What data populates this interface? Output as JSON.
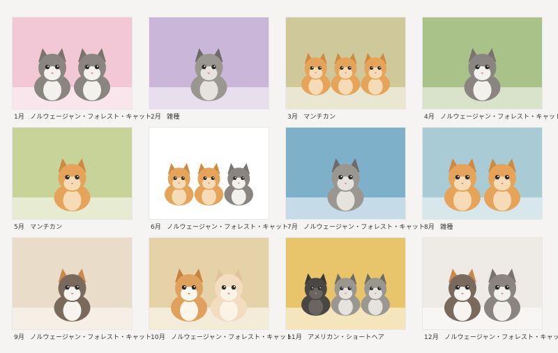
{
  "calendar": [
    {
      "month": "1月",
      "breed": "ノルウェージャン・フォレスト・キャット",
      "bg": "#f2c8d6",
      "cats": [
        "gray-white",
        "gray-white"
      ]
    },
    {
      "month": "2月",
      "breed": "雑種",
      "bg": "#c9b6d9",
      "cats": [
        "tabby"
      ]
    },
    {
      "month": "3月",
      "breed": "マンチカン",
      "bg": "#cfc89a",
      "cats": [
        "orange",
        "orange",
        "orange"
      ]
    },
    {
      "month": "4月",
      "breed": "ノルウェージャン・フォレスト・キャット",
      "bg": "#a8c28a",
      "cats": [
        "gray-white"
      ]
    },
    {
      "month": "5月",
      "breed": "マンチカン",
      "bg": "#c8d39a",
      "cats": [
        "orange"
      ]
    },
    {
      "month": "6月",
      "breed": "ノルウェージャン・フォレスト・キャット",
      "bg": "#ffffff",
      "cats": [
        "orange",
        "orange",
        "gray-white"
      ]
    },
    {
      "month": "7月",
      "breed": "ノルウェージャン・フォレスト・キャット",
      "bg": "#7fb0c9",
      "cats": [
        "tabby"
      ]
    },
    {
      "month": "8月",
      "breed": "雑種",
      "bg": "#a9cbd6",
      "cats": [
        "orange",
        "orange"
      ]
    },
    {
      "month": "9月",
      "breed": "ノルウェージャン・フォレスト・キャット",
      "bg": "#e9dcc8",
      "cats": [
        "calico"
      ]
    },
    {
      "month": "10月",
      "breed": "ノルウェージャン・フォレスト・キャット",
      "bg": "#e6d2a8",
      "cats": [
        "orange-white",
        "cream"
      ]
    },
    {
      "month": "11月",
      "breed": "アメリカン・ショートヘア",
      "bg": "#e8c56a",
      "cats": [
        "dark",
        "tabby",
        "tabby"
      ]
    },
    {
      "month": "12月",
      "breed": "ノルウェージャン・フォレスト・キャット",
      "bg": "#eeeae6",
      "cats": [
        "calico",
        "gray-white"
      ]
    }
  ]
}
